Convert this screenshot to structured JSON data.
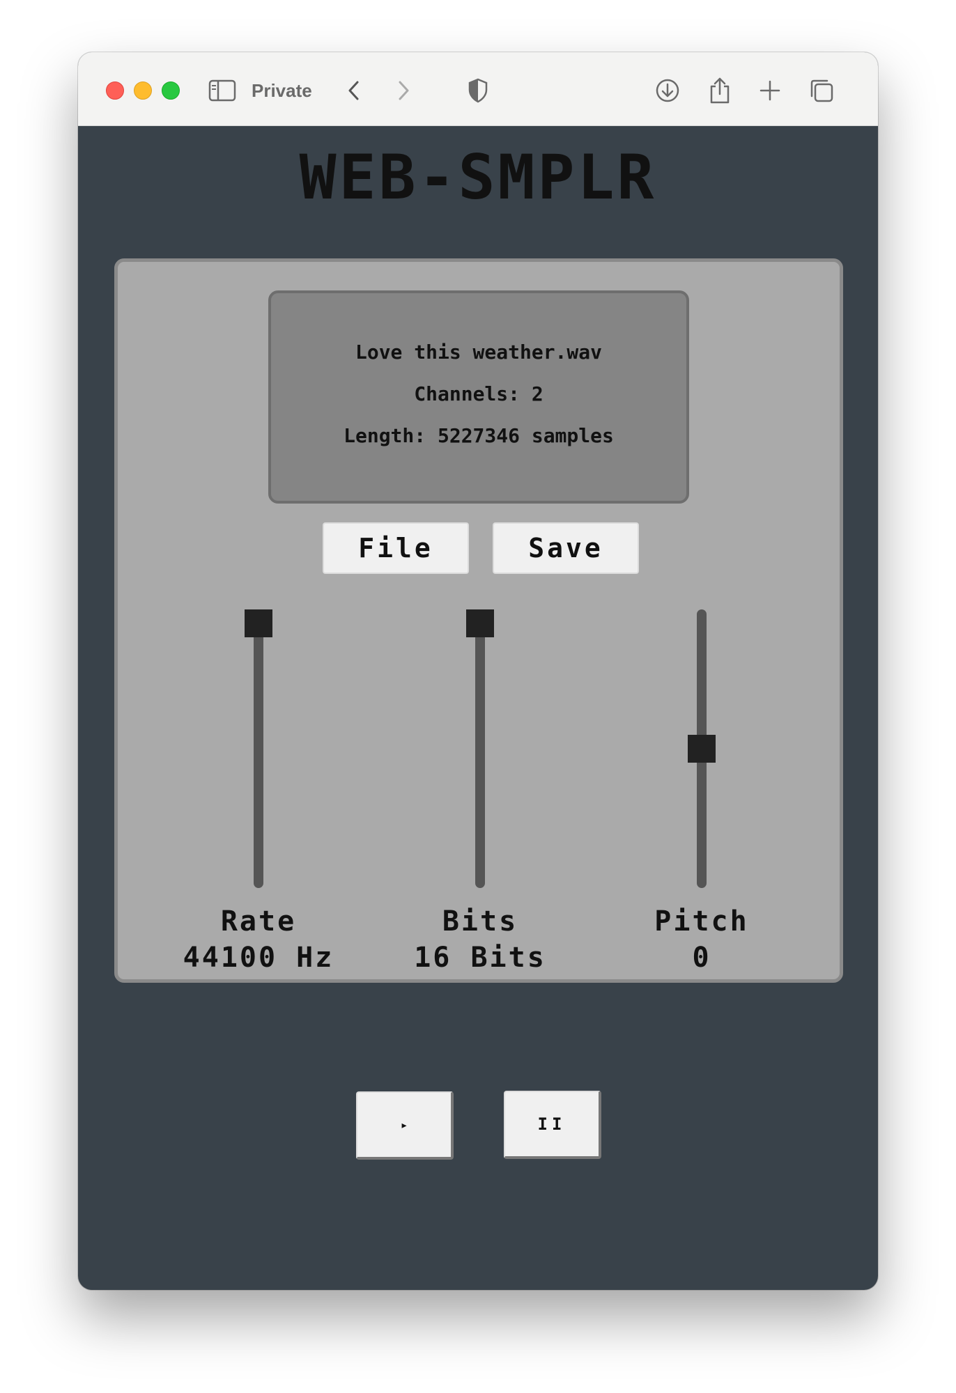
{
  "browser": {
    "mode_label": "Private",
    "icons": {
      "sidebar": "sidebar-icon",
      "back": "chevron-left-icon",
      "forward": "chevron-right-icon",
      "privacy": "shield-icon",
      "download": "download-icon",
      "share": "share-icon",
      "new_tab": "plus-icon",
      "tabs": "tabs-icon"
    }
  },
  "app": {
    "title": "WEB-SMPLR"
  },
  "display": {
    "filename": "Love this weather.wav",
    "channels": "Channels: 2",
    "length": "Length: 5227346 samples"
  },
  "buttons": {
    "file_label": "File",
    "save_label": "Save",
    "play_label": "▸",
    "pause_label": "II"
  },
  "controls": {
    "rate": {
      "label": "Rate",
      "value": "44100 Hz",
      "level": 1.0
    },
    "bits": {
      "label": "Bits",
      "value": "16 Bits",
      "level": 1.0
    },
    "pitch": {
      "label": "Pitch",
      "value": "0",
      "level": 0.5
    }
  },
  "colors": {
    "app_background": "#39424a",
    "panel": "#aaaaaa",
    "display": "#858585",
    "slider_thumb": "#222222"
  }
}
